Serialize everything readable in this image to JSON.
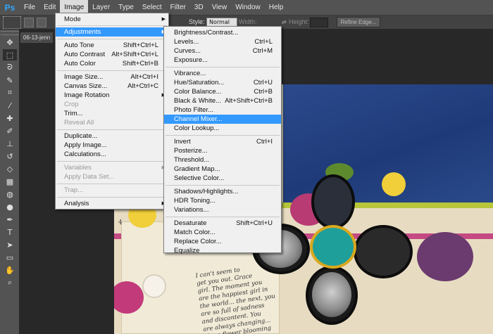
{
  "app": {
    "logo": "Ps"
  },
  "menubar": {
    "items": [
      {
        "label": "File"
      },
      {
        "label": "Edit"
      },
      {
        "label": "Image"
      },
      {
        "label": "Layer"
      },
      {
        "label": "Type"
      },
      {
        "label": "Select"
      },
      {
        "label": "Filter"
      },
      {
        "label": "3D"
      },
      {
        "label": "View"
      },
      {
        "label": "Window"
      },
      {
        "label": "Help"
      }
    ],
    "active_index": 2
  },
  "options": {
    "style_label": "Style:",
    "style_value": "Normal",
    "width_label": "Width:",
    "height_label": "Height:",
    "refine_edge": "Refine Edge..."
  },
  "document": {
    "tab_title": "06-13-jenn"
  },
  "image_menu": {
    "items": [
      {
        "label": "Mode",
        "shortcut": "",
        "submenu": true,
        "disabled": false
      },
      {
        "label": "Adjustments",
        "shortcut": "",
        "submenu": true,
        "disabled": false,
        "highlight": true
      },
      {
        "label": "Auto Tone",
        "shortcut": "Shift+Ctrl+L",
        "disabled": false
      },
      {
        "label": "Auto Contrast",
        "shortcut": "Alt+Shift+Ctrl+L",
        "disabled": false
      },
      {
        "label": "Auto Color",
        "shortcut": "Shift+Ctrl+B",
        "disabled": false
      },
      {
        "label": "Image Size...",
        "shortcut": "Alt+Ctrl+I",
        "disabled": false
      },
      {
        "label": "Canvas Size...",
        "shortcut": "Alt+Ctrl+C",
        "disabled": false
      },
      {
        "label": "Image Rotation",
        "shortcut": "",
        "submenu": true,
        "disabled": false
      },
      {
        "label": "Crop",
        "shortcut": "",
        "disabled": true
      },
      {
        "label": "Trim...",
        "shortcut": "",
        "disabled": false
      },
      {
        "label": "Reveal All",
        "shortcut": "",
        "disabled": true
      },
      {
        "label": "Duplicate...",
        "shortcut": "",
        "disabled": false
      },
      {
        "label": "Apply Image...",
        "shortcut": "",
        "disabled": false
      },
      {
        "label": "Calculations...",
        "shortcut": "",
        "disabled": false
      },
      {
        "label": "Variables",
        "shortcut": "",
        "submenu": true,
        "disabled": true
      },
      {
        "label": "Apply Data Set...",
        "shortcut": "",
        "disabled": true
      },
      {
        "label": "Trap...",
        "shortcut": "",
        "disabled": true
      },
      {
        "label": "Analysis",
        "shortcut": "",
        "submenu": true,
        "disabled": false
      }
    ]
  },
  "adjustments_menu": {
    "items": [
      {
        "label": "Brightness/Contrast...",
        "shortcut": ""
      },
      {
        "label": "Levels...",
        "shortcut": "Ctrl+L"
      },
      {
        "label": "Curves...",
        "shortcut": "Ctrl+M"
      },
      {
        "label": "Exposure...",
        "shortcut": ""
      },
      {
        "label": "Vibrance...",
        "shortcut": ""
      },
      {
        "label": "Hue/Saturation...",
        "shortcut": "Ctrl+U"
      },
      {
        "label": "Color Balance...",
        "shortcut": "Ctrl+B"
      },
      {
        "label": "Black & White...",
        "shortcut": "Alt+Shift+Ctrl+B"
      },
      {
        "label": "Photo Filter...",
        "shortcut": ""
      },
      {
        "label": "Channel Mixer...",
        "shortcut": "",
        "highlight": true
      },
      {
        "label": "Color Lookup...",
        "shortcut": ""
      },
      {
        "label": "Invert",
        "shortcut": "Ctrl+I"
      },
      {
        "label": "Posterize...",
        "shortcut": ""
      },
      {
        "label": "Threshold...",
        "shortcut": ""
      },
      {
        "label": "Gradient Map...",
        "shortcut": ""
      },
      {
        "label": "Selective Color...",
        "shortcut": ""
      },
      {
        "label": "Shadows/Highlights...",
        "shortcut": ""
      },
      {
        "label": "HDR Toning...",
        "shortcut": ""
      },
      {
        "label": "Variations...",
        "shortcut": ""
      },
      {
        "label": "Desaturate",
        "shortcut": "Shift+Ctrl+U"
      },
      {
        "label": "Match Color...",
        "shortcut": ""
      },
      {
        "label": "Replace Color...",
        "shortcut": ""
      },
      {
        "label": "Equalize",
        "shortcut": ""
      }
    ]
  },
  "artwork": {
    "page_number": "4",
    "handwriting": "I can't seem to\nget you out. Grace\ngirl. The moment you\nare the happiest girl in\nthe world... the next, you\nare so full of sadness\nand discontent. You\nare always changing...\nlike a flower blooming\nand..."
  },
  "colors": {
    "menu_highlight": "#3399ff",
    "ps_blue": "#31a8ff"
  }
}
